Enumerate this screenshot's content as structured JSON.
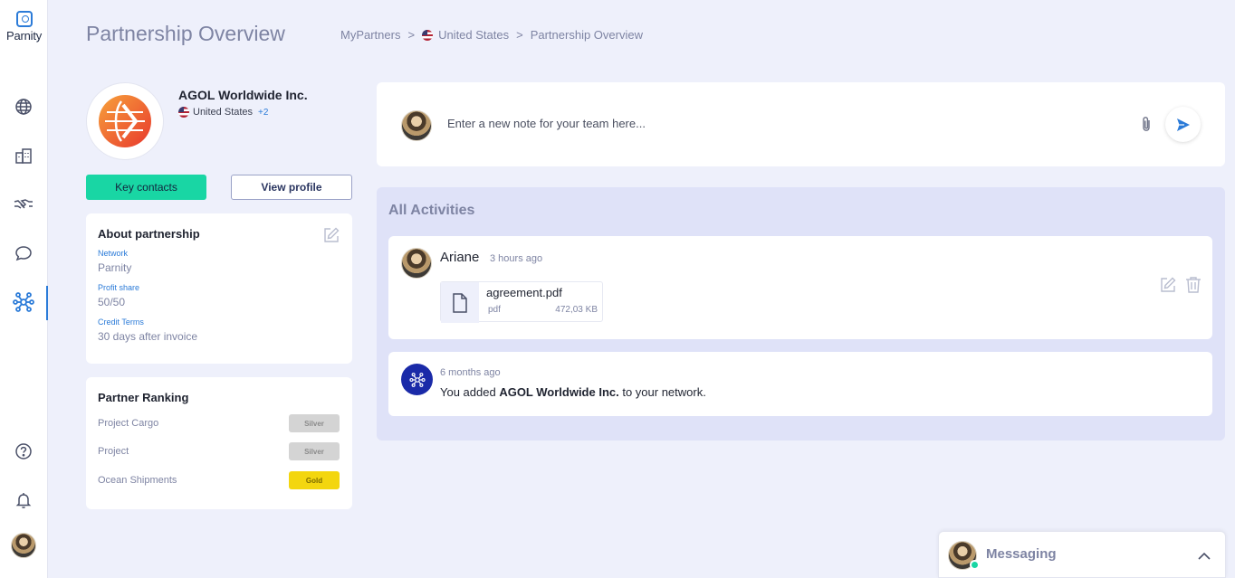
{
  "app": {
    "logo_text": "Parnity"
  },
  "header": {
    "title": "Partnership Overview",
    "breadcrumb": [
      "MyPartners",
      "United States",
      "Partnership Overview"
    ]
  },
  "company": {
    "name": "AGOL Worldwide Inc.",
    "country": "United States",
    "extra_countries": "+2"
  },
  "buttons": {
    "key_contacts": "Key contacts",
    "view_profile": "View profile"
  },
  "about": {
    "title": "About partnership",
    "fields": [
      {
        "label": "Network",
        "value": "Parnity"
      },
      {
        "label": "Profit share",
        "value": "50/50"
      },
      {
        "label": "Credit Terms",
        "value": "30 days after invoice"
      }
    ]
  },
  "ranking": {
    "title": "Partner Ranking",
    "rows": [
      {
        "name": "Project Cargo",
        "level": "Silver"
      },
      {
        "name": "Project",
        "level": "Silver"
      },
      {
        "name": "Ocean Shipments",
        "level": "Gold"
      }
    ]
  },
  "note": {
    "placeholder": "Enter a new note for your team here..."
  },
  "activities": {
    "title": "All Activities",
    "items": [
      {
        "author": "Ariane",
        "time": "3 hours ago",
        "file_name": "agreement.pdf",
        "file_type": "pdf",
        "file_size": "472,03 KB"
      },
      {
        "time": "6 months ago",
        "text_prefix": "You added ",
        "text_bold": "AGOL Worldwide Inc.",
        "text_suffix": " to your network."
      }
    ]
  },
  "messaging": {
    "title": "Messaging"
  },
  "colors": {
    "accent": "#2b7bd8",
    "primary_button": "#19d6a4",
    "gold": "#f3d60f",
    "silver": "#d4d4d4",
    "muted": "#7e84a3"
  }
}
